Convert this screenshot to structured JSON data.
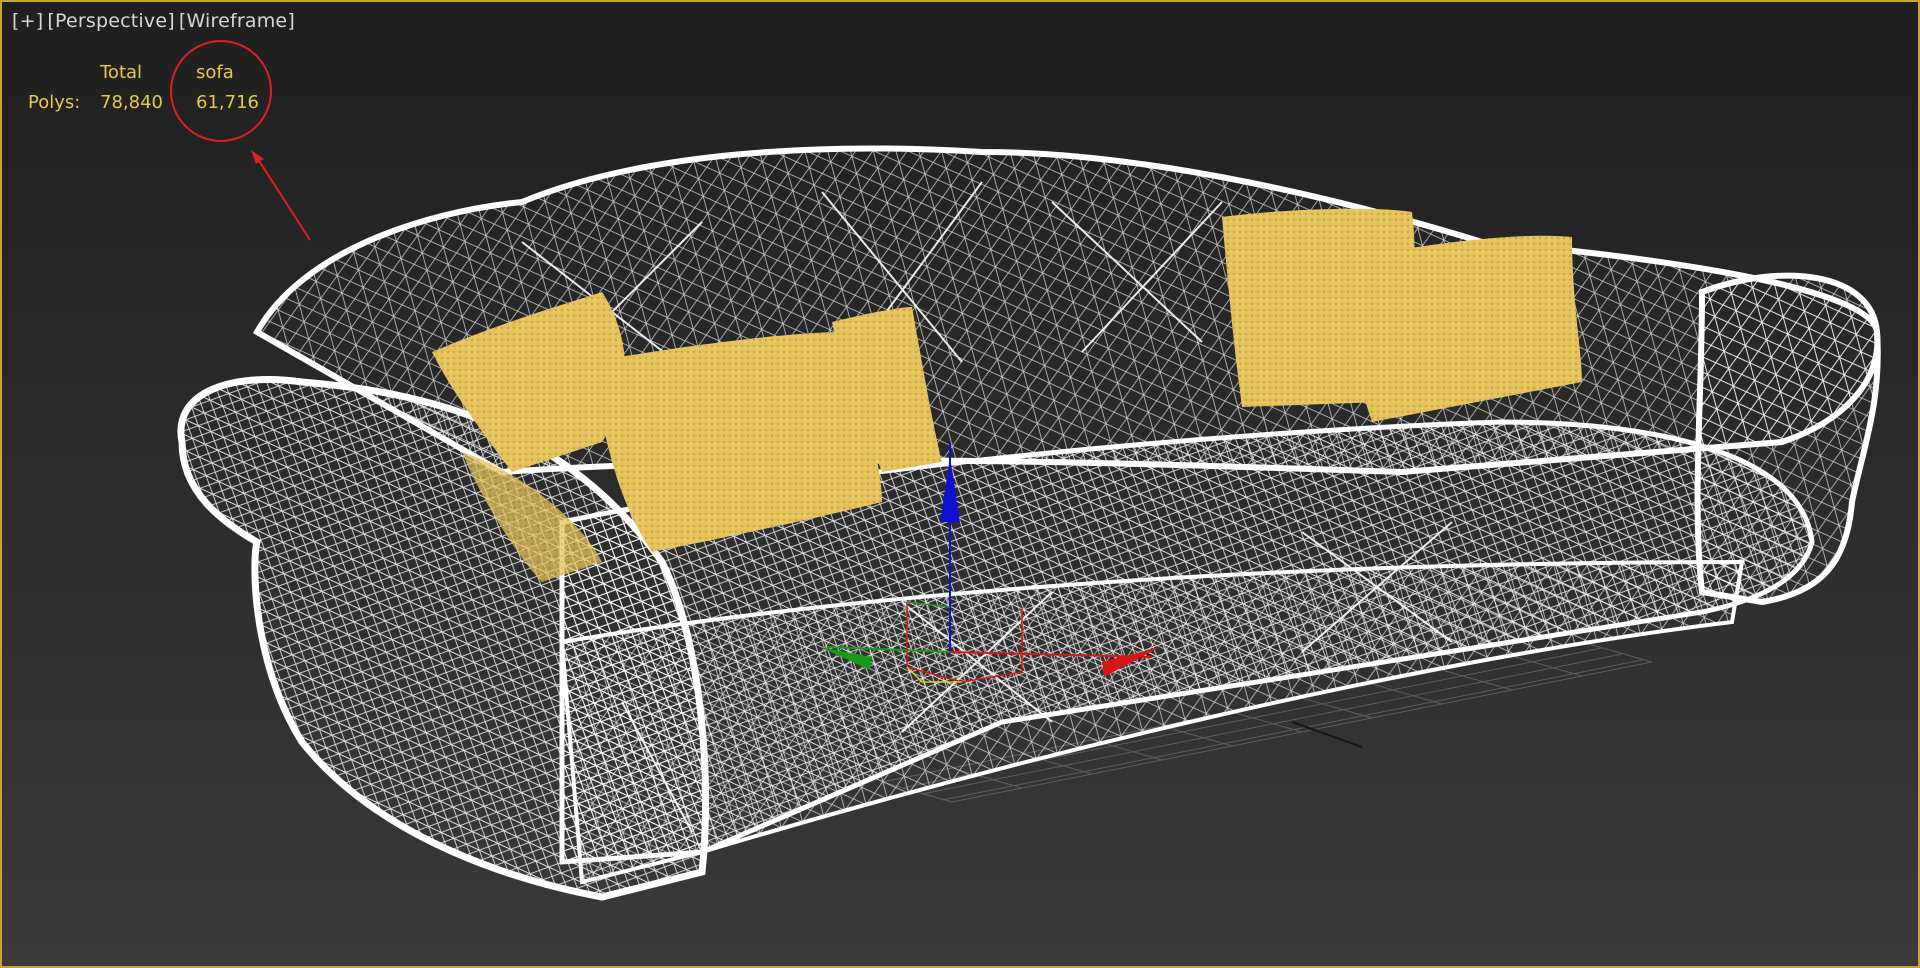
{
  "viewport": {
    "label_plus": "[+]",
    "label_view": "[Perspective]",
    "label_shading": "[Wireframe]",
    "border_color": "#c8a632"
  },
  "stats": {
    "total_header": "Total",
    "object_header": "sofa",
    "polys_label": "Polys:",
    "total_polys": "78,840",
    "object_polys": "61,716",
    "text_color": "#e6c84a"
  },
  "annotation": {
    "circle_color": "#e02020",
    "arrow_color": "#e02020"
  },
  "scene": {
    "object_name": "sofa",
    "wire_color": "#ffffff",
    "pillow_color": "#e6c35a",
    "gizmo_x_color": "#d41818",
    "gizmo_y_color": "#1a9a1a",
    "gizmo_z_color": "#1010d0",
    "grid_color": "#6a6a6a"
  }
}
